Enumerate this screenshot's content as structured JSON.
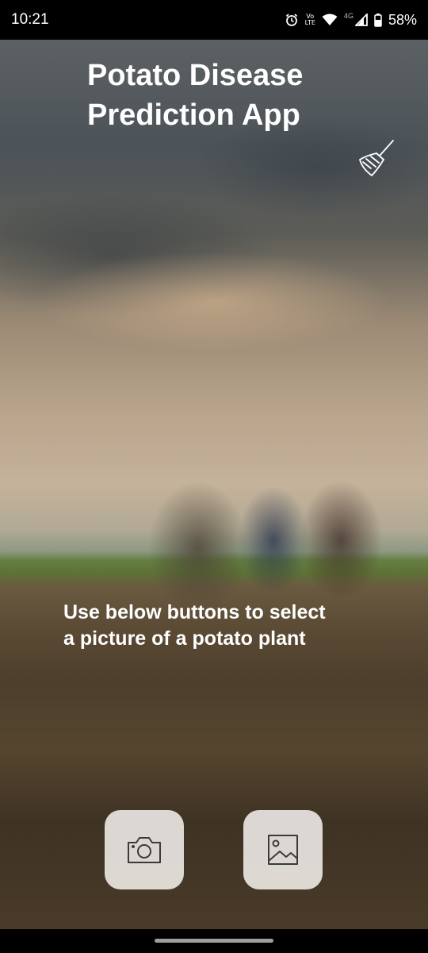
{
  "status_bar": {
    "time": "10:21",
    "volte_line1": "Vo",
    "volte_line2": "LTE",
    "network": "4G",
    "battery": "58%",
    "icons": [
      "alarm-icon",
      "volte-icon",
      "wifi-icon",
      "signal-icon",
      "battery-icon"
    ]
  },
  "app": {
    "title_line1": "Potato Disease",
    "title_line2": "Prediction App",
    "clear_icon": "broom-icon",
    "instruction_line1": "Use below buttons to select",
    "instruction_line2": "a picture of a potato plant",
    "camera_icon": "camera-icon",
    "gallery_icon": "image-icon"
  },
  "colors": {
    "text": "#ffffff",
    "button_bg": "#e8e4e0",
    "icon_stroke": "#3a3a3a",
    "status_bar_bg": "#000000"
  }
}
